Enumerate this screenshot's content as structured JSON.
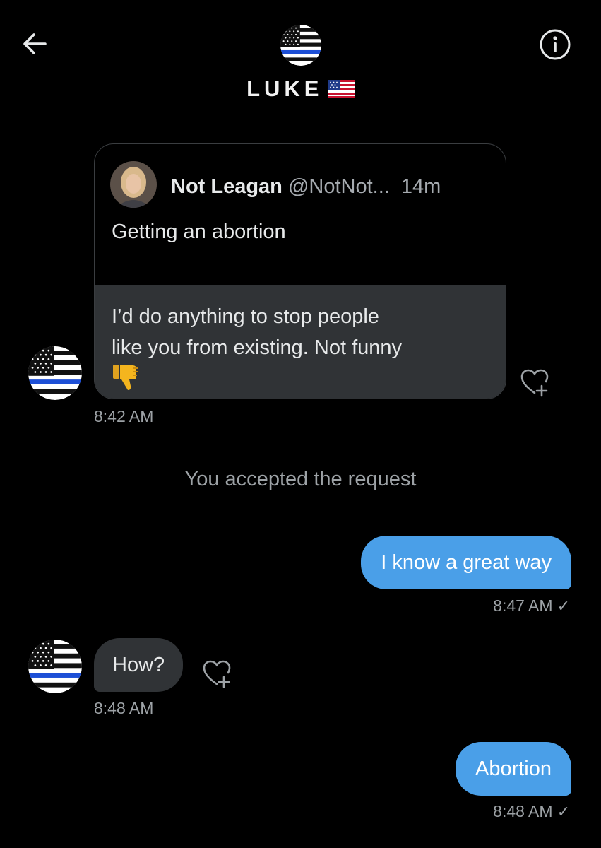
{
  "header": {
    "name": "LUKE",
    "back_icon": "arrow-left-icon",
    "info_icon": "info-icon",
    "flag_icon": "us-flag-icon"
  },
  "quoted_tweet": {
    "author_name": "Not Leagan",
    "handle": "@NotNot...",
    "time": "14m",
    "text": "Getting an abortion"
  },
  "messages": [
    {
      "direction": "received",
      "text_lines": [
        "I’d do anything to stop people",
        "like you from existing. Not funny"
      ],
      "emoji": "thumbs-down-icon",
      "time": "8:42 AM"
    },
    {
      "direction": "system",
      "text": "You accepted the request"
    },
    {
      "direction": "sent",
      "text": "I know a great way",
      "time": "8:47 AM",
      "status": "✓"
    },
    {
      "direction": "received",
      "text": "How?",
      "time": "8:48 AM"
    },
    {
      "direction": "sent",
      "text": "Abortion",
      "time": "8:48 AM",
      "status": "✓"
    }
  ],
  "colors": {
    "background": "#000000",
    "sent_bubble": "#4a9fe8",
    "received_bubble": "#303336",
    "muted_text": "#9da2a6"
  }
}
